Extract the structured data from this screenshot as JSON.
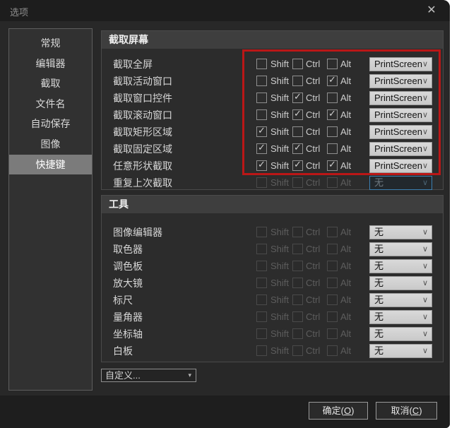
{
  "window": {
    "title": "选项",
    "close_icon": "✕"
  },
  "sidebar": {
    "items": [
      {
        "label": "常规",
        "selected": false
      },
      {
        "label": "编辑器",
        "selected": false
      },
      {
        "label": "截取",
        "selected": false
      },
      {
        "label": "文件名",
        "selected": false
      },
      {
        "label": "自动保存",
        "selected": false
      },
      {
        "label": "图像",
        "selected": false
      },
      {
        "label": "快捷键",
        "selected": true
      }
    ]
  },
  "modifiers": {
    "shift": "Shift",
    "ctrl": "Ctrl",
    "alt": "Alt"
  },
  "sections": [
    {
      "title": "截取屏幕",
      "rows": [
        {
          "label": "截取全屏",
          "shift": false,
          "ctrl": false,
          "alt": false,
          "enabled": true,
          "key": "PrintScreen",
          "dark_focus": false
        },
        {
          "label": "截取活动窗口",
          "shift": false,
          "ctrl": false,
          "alt": true,
          "enabled": true,
          "key": "PrintScreen",
          "dark_focus": false
        },
        {
          "label": "截取窗口控件",
          "shift": false,
          "ctrl": true,
          "alt": false,
          "enabled": true,
          "key": "PrintScreen",
          "dark_focus": false
        },
        {
          "label": "截取滚动窗口",
          "shift": false,
          "ctrl": true,
          "alt": true,
          "enabled": true,
          "key": "PrintScreen",
          "dark_focus": false
        },
        {
          "label": "截取矩形区域",
          "shift": true,
          "ctrl": false,
          "alt": false,
          "enabled": true,
          "key": "PrintScreen",
          "dark_focus": false
        },
        {
          "label": "截取固定区域",
          "shift": true,
          "ctrl": true,
          "alt": false,
          "enabled": true,
          "key": "PrintScreen",
          "dark_focus": false
        },
        {
          "label": "任意形状截取",
          "shift": true,
          "ctrl": true,
          "alt": true,
          "enabled": true,
          "key": "PrintScreen",
          "dark_focus": false
        },
        {
          "label": "重复上次截取",
          "shift": false,
          "ctrl": false,
          "alt": false,
          "enabled": false,
          "key": "无",
          "dark_focus": true
        }
      ]
    },
    {
      "title": "工具",
      "rows": [
        {
          "label": "图像编辑器",
          "shift": false,
          "ctrl": false,
          "alt": false,
          "enabled": false,
          "key": "无",
          "dark_focus": false
        },
        {
          "label": "取色器",
          "shift": false,
          "ctrl": false,
          "alt": false,
          "enabled": false,
          "key": "无",
          "dark_focus": false
        },
        {
          "label": "调色板",
          "shift": false,
          "ctrl": false,
          "alt": false,
          "enabled": false,
          "key": "无",
          "dark_focus": false
        },
        {
          "label": "放大镜",
          "shift": false,
          "ctrl": false,
          "alt": false,
          "enabled": false,
          "key": "无",
          "dark_focus": false
        },
        {
          "label": "标尺",
          "shift": false,
          "ctrl": false,
          "alt": false,
          "enabled": false,
          "key": "无",
          "dark_focus": false
        },
        {
          "label": "量角器",
          "shift": false,
          "ctrl": false,
          "alt": false,
          "enabled": false,
          "key": "无",
          "dark_focus": false
        },
        {
          "label": "坐标轴",
          "shift": false,
          "ctrl": false,
          "alt": false,
          "enabled": false,
          "key": "无",
          "dark_focus": false
        },
        {
          "label": "白板",
          "shift": false,
          "ctrl": false,
          "alt": false,
          "enabled": false,
          "key": "无",
          "dark_focus": false
        }
      ]
    }
  ],
  "icons": {
    "checkmark": "✓",
    "chevron_down": "∨",
    "triangle_down": "▾"
  },
  "footer": {
    "preset": "自定义...",
    "ok": "确定(O)",
    "cancel": "取消(C)"
  },
  "colors": {
    "highlight_red": "#bb1717",
    "selected_sidebar": "#7b7b7b",
    "dropdown_light": "#d2d2d2",
    "focus_border_blue": "#3c7fb1"
  }
}
